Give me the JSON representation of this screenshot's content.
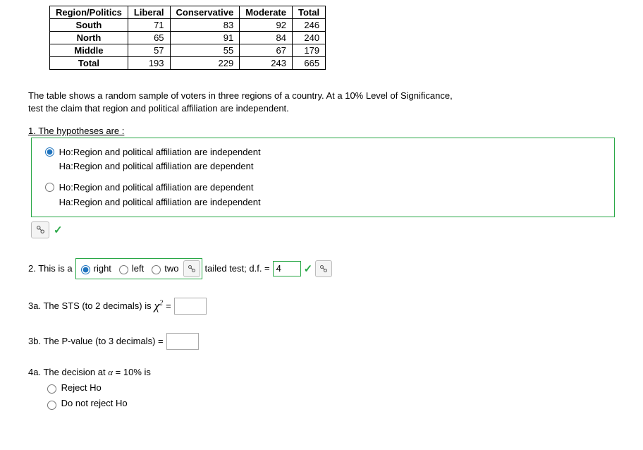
{
  "table": {
    "headers": [
      "Region/Politics",
      "Liberal",
      "Conservative",
      "Moderate",
      "Total"
    ],
    "rows": [
      {
        "label": "South",
        "vals": [
          "71",
          "83",
          "92",
          "246"
        ]
      },
      {
        "label": "North",
        "vals": [
          "65",
          "91",
          "84",
          "240"
        ]
      },
      {
        "label": "Middle",
        "vals": [
          "57",
          "55",
          "67",
          "179"
        ]
      },
      {
        "label": "Total",
        "vals": [
          "193",
          "229",
          "243",
          "665"
        ]
      }
    ]
  },
  "prompt_line1": "The table shows a random sample of voters in three regions of a country. At a 10% Level of Significance,",
  "prompt_line2": "test the claim that region and political affiliation are independent.",
  "q1": {
    "label": "1. The hypotheses are :",
    "opt1_h0": "Ho:Region and political affiliation are independent",
    "opt1_ha": "Ha:Region and political affiliation are dependent",
    "opt2_h0": "Ho:Region and political affiliation are dependent",
    "opt2_ha": "Ha:Region and political affiliation are independent"
  },
  "q2": {
    "prefix": "2. This is a",
    "right": "right",
    "left": "left",
    "two": "two",
    "mid": "tailed test; d.f. =",
    "df_value": "4"
  },
  "q3a": {
    "text_pre": "3a. The STS (to 2 decimals) is ",
    "chi": "χ",
    "sq": "2",
    "eq": " ="
  },
  "q3b": {
    "text": "3b. The P-value (to 3 decimals) ="
  },
  "q4": {
    "label_pre": "4a. The decision at ",
    "alpha": "α",
    "label_post": " = 10% is",
    "opt1": "Reject Ho",
    "opt2": "Do not reject Ho"
  },
  "icons": {
    "recalc": "⚄",
    "check": "✓"
  }
}
